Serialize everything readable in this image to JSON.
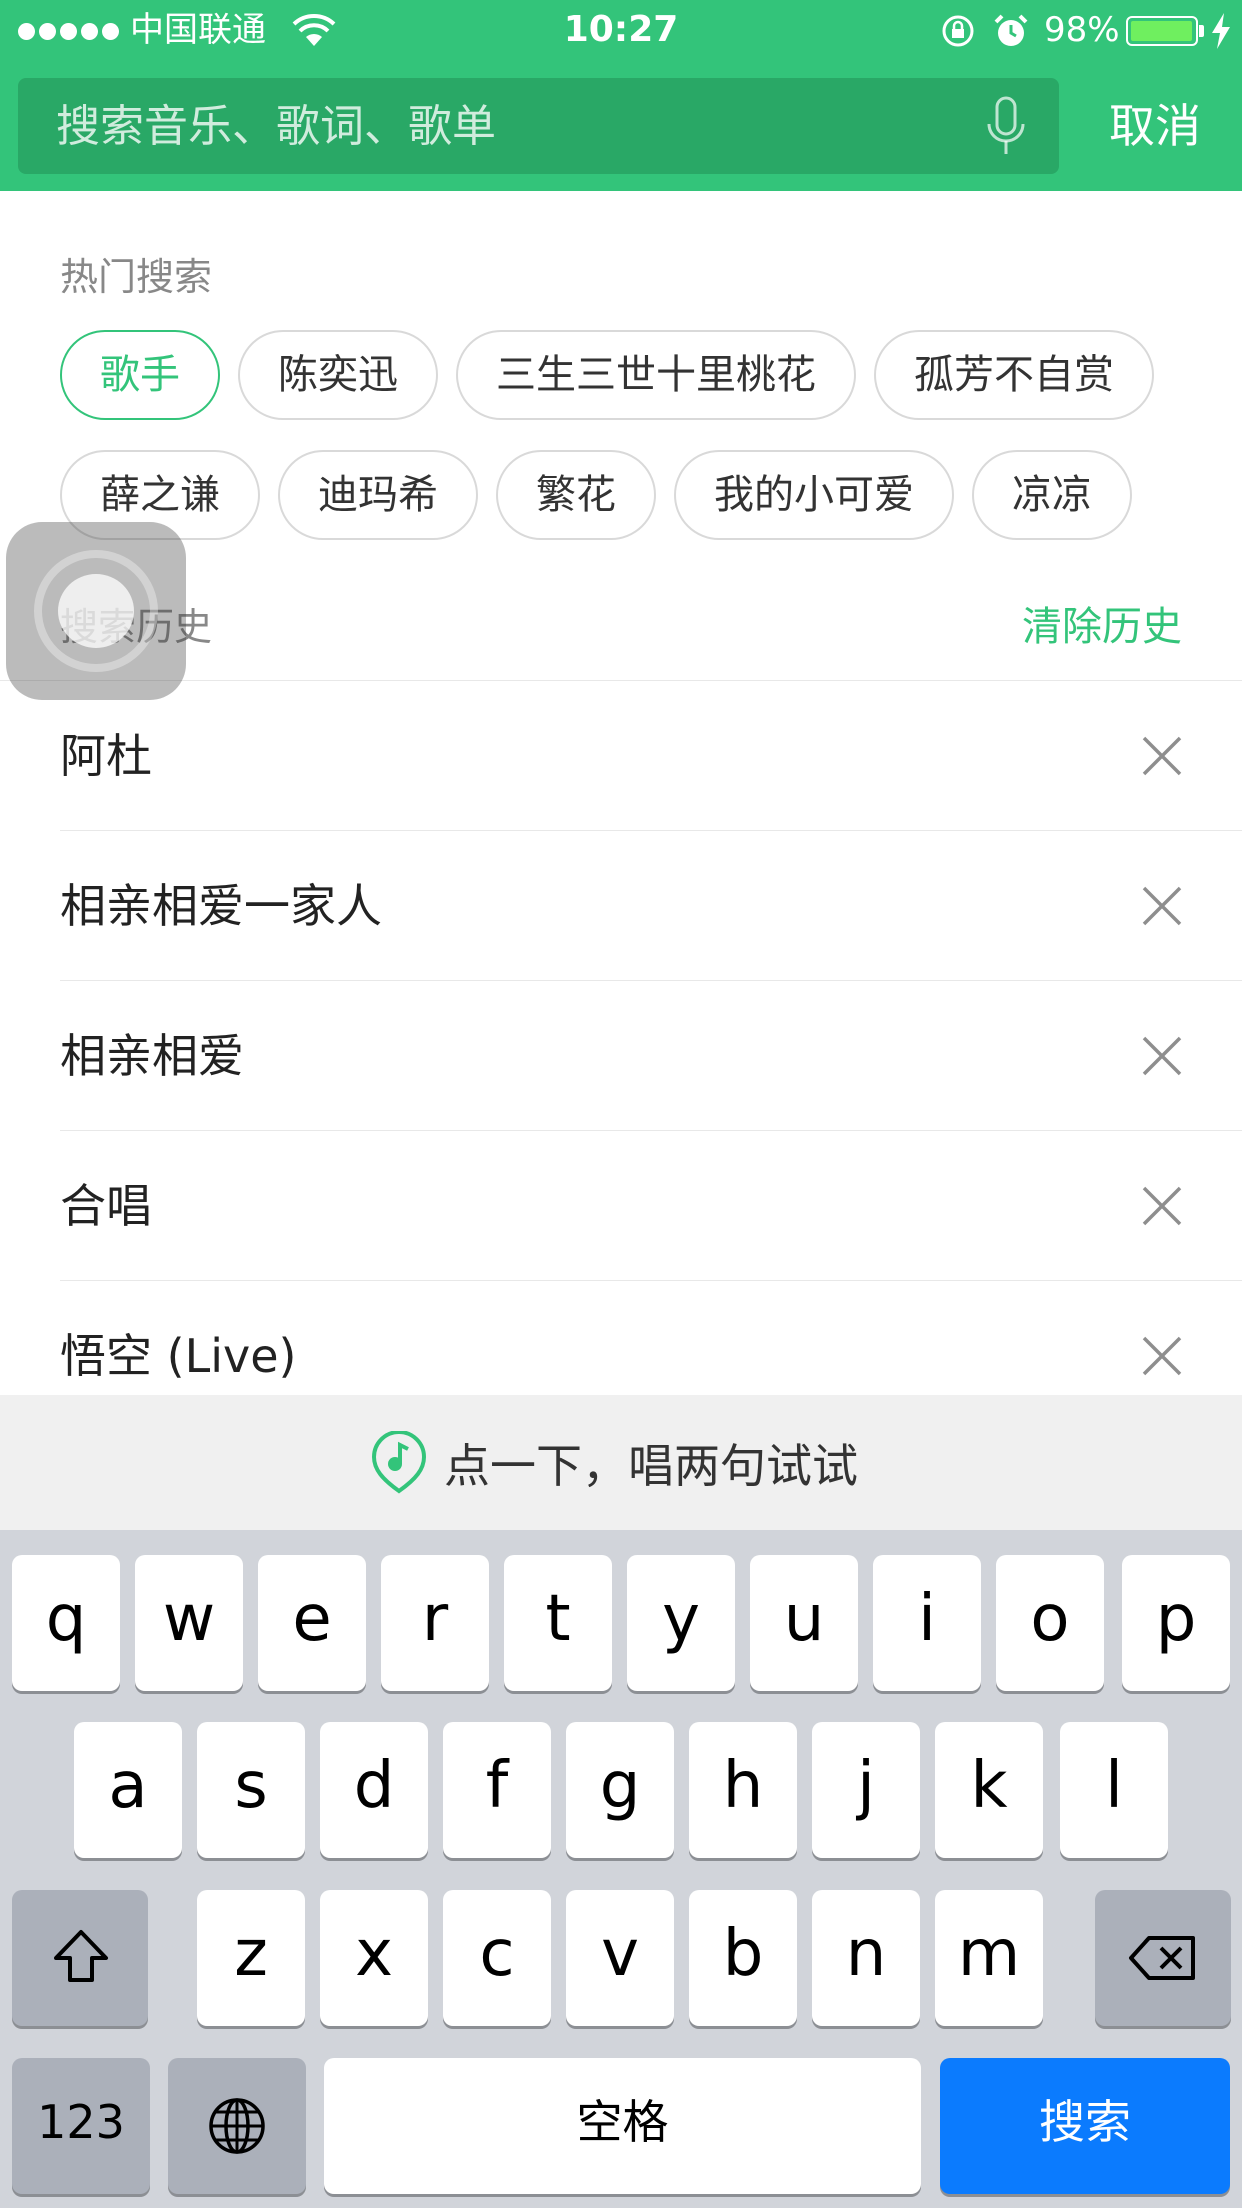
{
  "status_bar": {
    "carrier": "中国联通",
    "time": "10:27",
    "battery_percent": "98%",
    "battery_level": 0.98,
    "icons": [
      "signal-dots-icon",
      "wifi-icon",
      "rotation-lock-icon",
      "alarm-icon",
      "battery-icon",
      "charging-bolt-icon"
    ]
  },
  "search": {
    "placeholder": "搜索音乐、歌词、歌单",
    "value": "",
    "mic_icon": "microphone-icon",
    "cancel_label": "取消"
  },
  "hot_search": {
    "title": "热门搜索",
    "rows": [
      [
        "歌手",
        "陈奕迅",
        "三生三世十里桃花",
        "孤芳不自赏"
      ],
      [
        "薛之谦",
        "迪玛希",
        "繁花",
        "我的小可爱",
        "凉凉"
      ]
    ],
    "active_tag": "歌手"
  },
  "history": {
    "title": "搜索历史",
    "clear_label": "清除历史",
    "items": [
      "阿杜",
      "相亲相爱一家人",
      "相亲相爱",
      "合唱",
      "悟空 (Live)"
    ],
    "delete_icon": "close-icon"
  },
  "sing_banner": {
    "text": "点一下，唱两句试试",
    "icon": "sing-recognition-icon"
  },
  "keyboard": {
    "row1": [
      "q",
      "w",
      "e",
      "r",
      "t",
      "y",
      "u",
      "i",
      "o",
      "p"
    ],
    "row2": [
      "a",
      "s",
      "d",
      "f",
      "g",
      "h",
      "j",
      "k",
      "l"
    ],
    "row3": [
      "z",
      "x",
      "c",
      "v",
      "b",
      "n",
      "m"
    ],
    "numbers_label": "123",
    "space_label": "空格",
    "search_label": "搜索",
    "icons": [
      "shift-icon",
      "backspace-icon",
      "globe-icon"
    ]
  },
  "colors": {
    "accent": "#33c47a",
    "search_field": "#29a866",
    "keyboard_bg": "#d1d4da",
    "return_key": "#0b7bfe"
  }
}
